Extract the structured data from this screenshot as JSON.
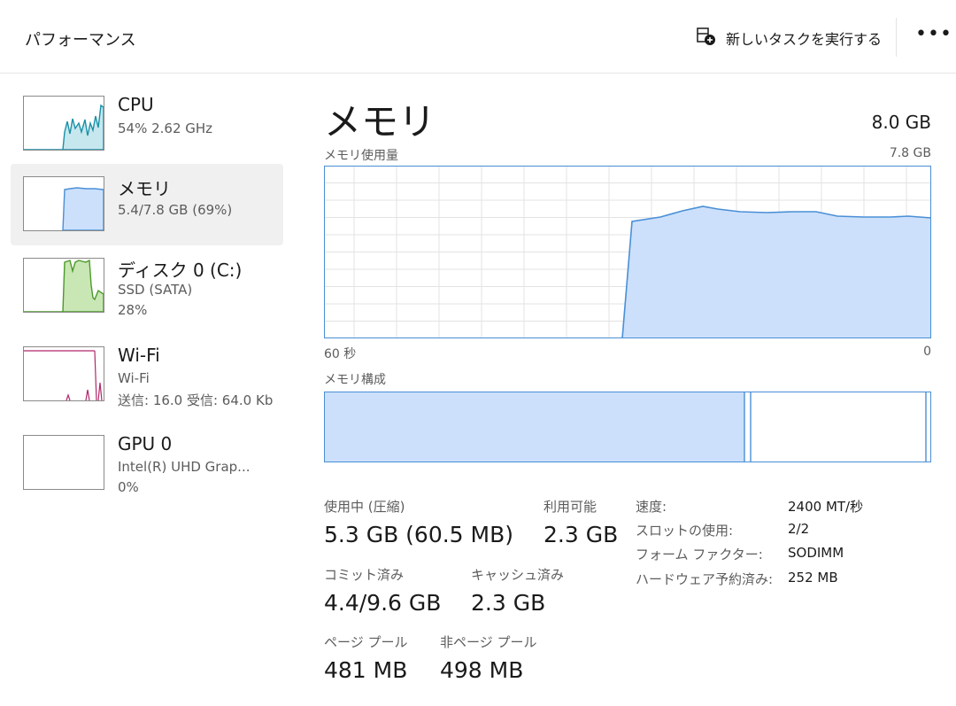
{
  "header": {
    "title": "パフォーマンス",
    "run_task_label": "新しいタスクを実行する",
    "more_label": "•••"
  },
  "sidebar": {
    "items": [
      {
        "title": "CPU",
        "line1": "54%  2.62 GHz",
        "line2": "",
        "usage_percent": 54,
        "graph_color": "#1a91a8",
        "selected": false
      },
      {
        "title": "メモリ",
        "line1": "5.4/7.8 GB (69%)",
        "line2": "",
        "usage_percent": 69,
        "graph_color": "#4a8fd6",
        "selected": true
      },
      {
        "title": "ディスク 0 (C:)",
        "line1": "SSD (SATA)",
        "line2": "28%",
        "usage_percent": 28,
        "graph_color": "#4c9a2a",
        "selected": false
      },
      {
        "title": "Wi-Fi",
        "line1": "Wi-Fi",
        "line2": "送信: 16.0 受信: 64.0 Kb",
        "graph_color": "#b0286a",
        "selected": false
      },
      {
        "title": "GPU 0",
        "line1": "Intel(R) UHD Grap...",
        "line2": "0%",
        "usage_percent": 0,
        "selected": false
      }
    ]
  },
  "main": {
    "title": "メモリ",
    "total": "8.0 GB",
    "usage_label": "メモリ使用量",
    "usage_max": "7.8 GB",
    "axis_left": "60 秒",
    "axis_right": "0",
    "composition_label": "メモリ構成",
    "accent": "#4a8fd6",
    "fill": "#cce0fb"
  },
  "stats": {
    "in_use_label": "使用中 (圧縮)",
    "in_use_value": "5.3 GB (60.5 MB)",
    "available_label": "利用可能",
    "available_value": "2.3 GB",
    "committed_label": "コミット済み",
    "committed_value": "4.4/9.6 GB",
    "cached_label": "キャッシュ済み",
    "cached_value": "2.3 GB",
    "paged_label": "ページ プール",
    "paged_value": "481 MB",
    "nonpaged_label": "非ページ プール",
    "nonpaged_value": "498 MB"
  },
  "details": {
    "speed_label": "速度:",
    "speed_value": "2400 MT/秒",
    "slots_label": "スロットの使用:",
    "slots_value": "2/2",
    "form_label": "フォーム ファクター:",
    "form_value": "SODIMM",
    "reserved_label": "ハードウェア予約済み:",
    "reserved_value": "252 MB"
  }
}
